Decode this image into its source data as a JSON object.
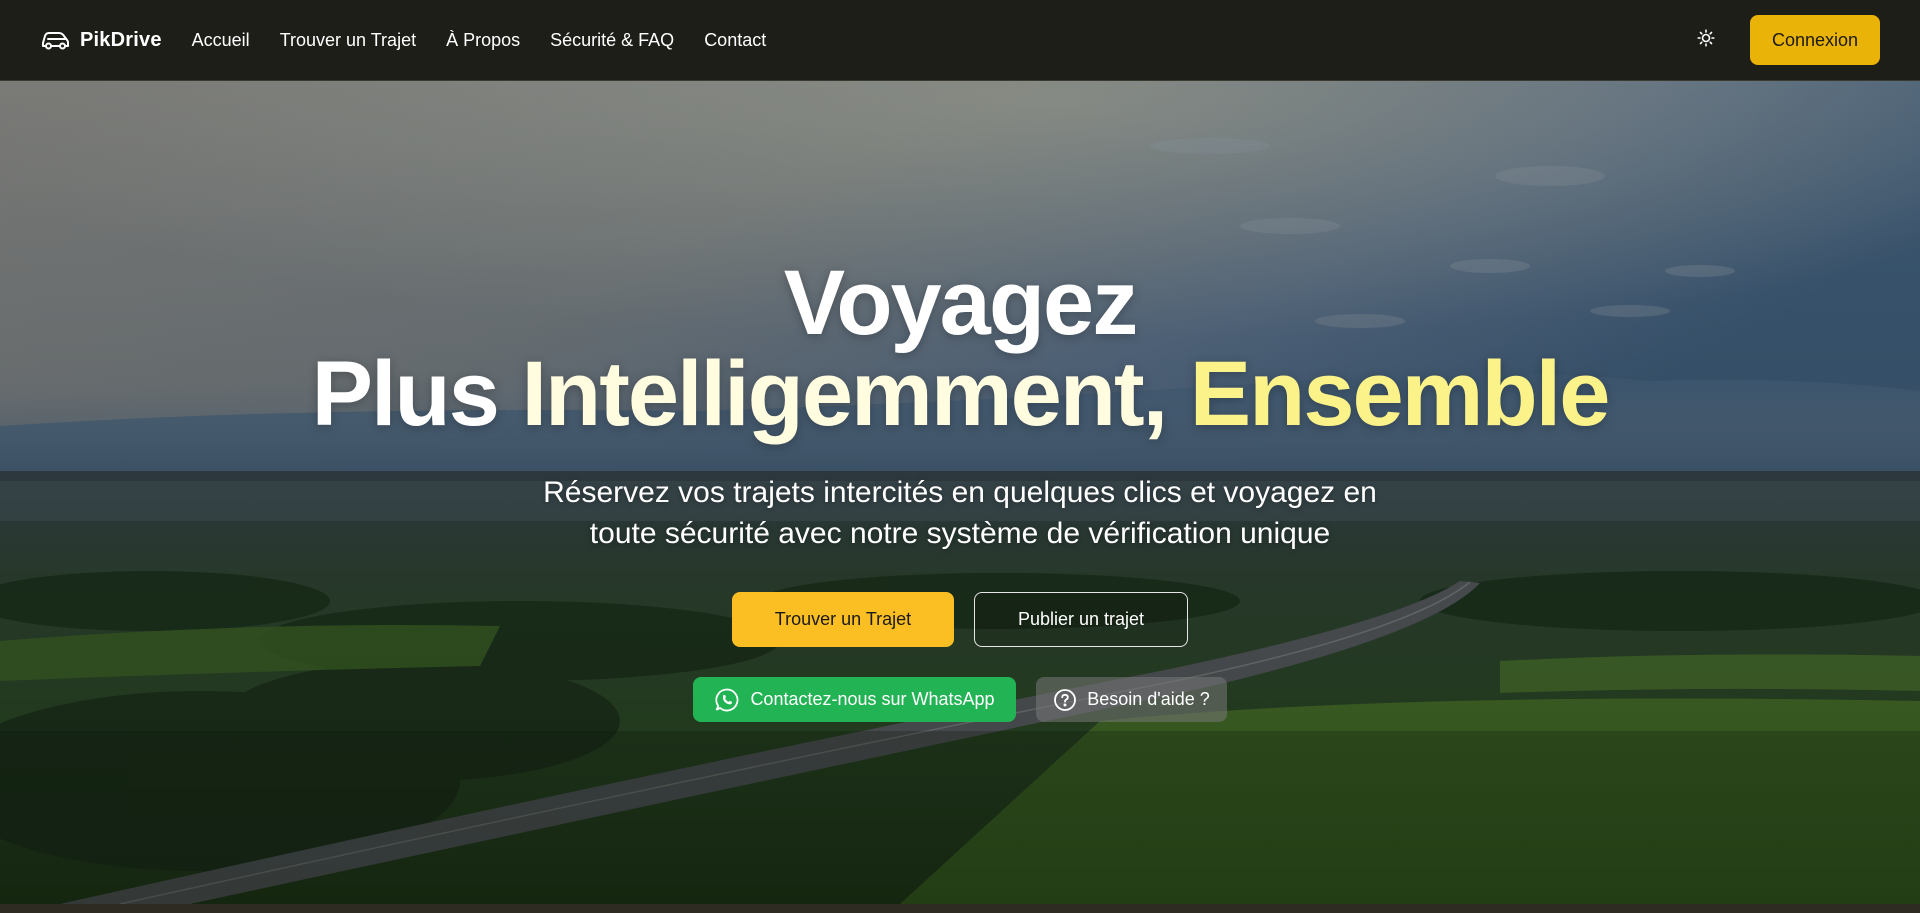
{
  "brand": {
    "name": "PikDrive",
    "icon": "car-icon"
  },
  "nav": {
    "links": [
      {
        "label": "Accueil"
      },
      {
        "label": "Trouver un Trajet"
      },
      {
        "label": "À Propos"
      },
      {
        "label": "Sécurité & FAQ"
      },
      {
        "label": "Contact"
      }
    ],
    "theme_icon": "sun-icon",
    "login_label": "Connexion"
  },
  "hero": {
    "headline_line1": "Voyagez",
    "headline_plus": "Plus ",
    "headline_intelligemment": "Intelligemment,",
    "headline_ensemble": " Ensemble",
    "subtitle_line1": "Réservez vos trajets intercités en quelques clics et voyagez en",
    "subtitle_line2": "toute sécurité avec notre système de vérification unique",
    "primary_button": "Trouver un Trajet",
    "secondary_button": "Publier un trajet",
    "whatsapp_button": "Contactez-nous sur WhatsApp",
    "whatsapp_icon": "whatsapp-icon",
    "help_button": "Besoin d'aide ?",
    "help_icon": "help-circle-icon"
  },
  "colors": {
    "accent": "#eab308",
    "primary_button": "#fbbf24",
    "highlight_text": "#fcf28a",
    "whatsapp": "#22b454",
    "navbar_bg": "#1e1e19"
  }
}
